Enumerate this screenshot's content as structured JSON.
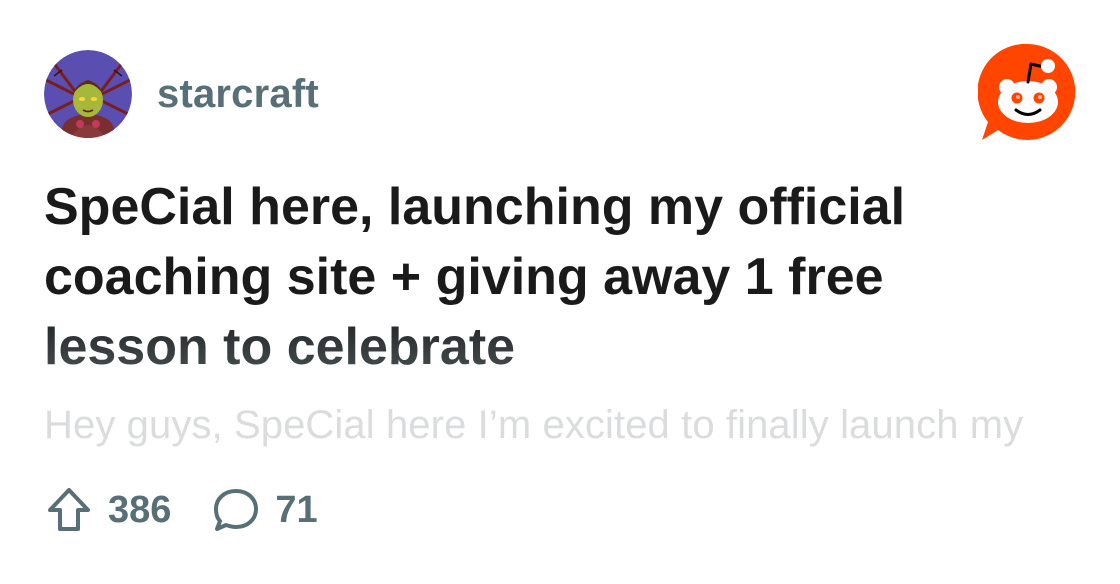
{
  "post": {
    "subreddit": "starcraft",
    "title": "SpeCial here, launching my official coaching site + giving away 1 free lesson to celebrate",
    "body_preview": "Hey guys, SpeCial here I’m excited to finally launch my",
    "upvotes": "386",
    "comments": "71"
  },
  "icons": {
    "avatar": "subreddit-avatar-kerrigan",
    "logo": "reddit-snoo-logo",
    "upvote": "upvote-arrow-icon",
    "comment": "comment-bubble-icon"
  },
  "colors": {
    "brand": "#ff4500",
    "muted_text": "#576f76",
    "title_text": "#1a1a1b",
    "preview_text": "#dadcdd"
  }
}
